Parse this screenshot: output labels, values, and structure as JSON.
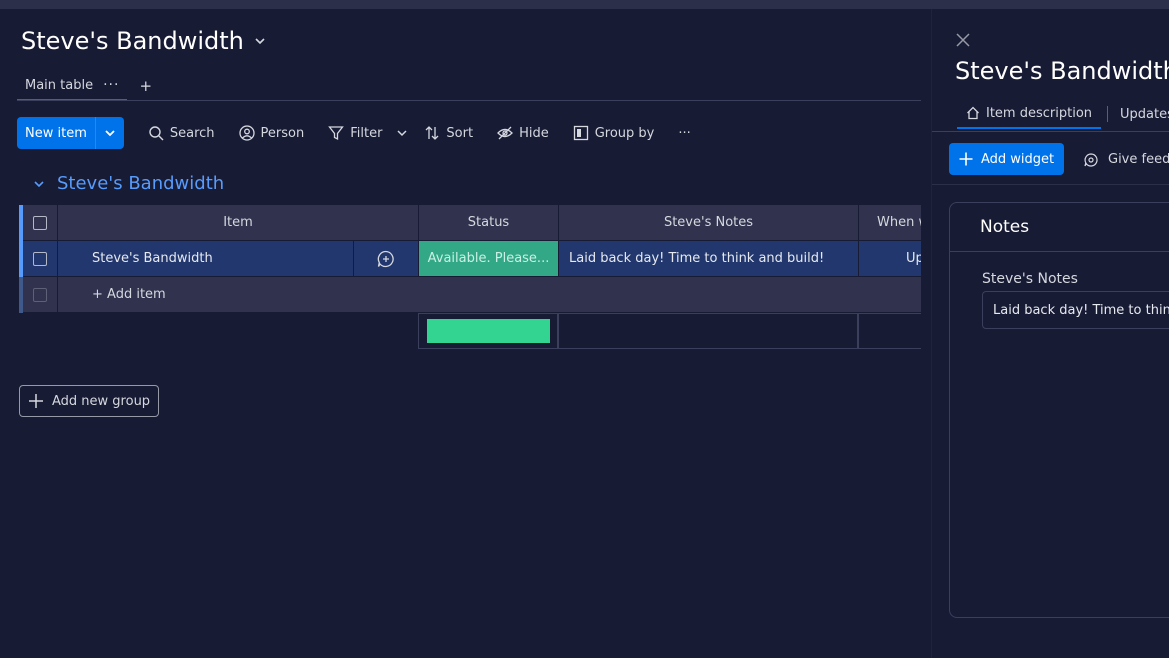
{
  "board": {
    "title": "Steve's Bandwidth",
    "tab_main": "Main table",
    "tab_dots": "···",
    "tab_add": "+"
  },
  "toolbar": {
    "new_item": "New item",
    "search": "Search",
    "person": "Person",
    "filter": "Filter",
    "sort": "Sort",
    "hide": "Hide",
    "group_by": "Group by",
    "more": "···"
  },
  "group": {
    "name": "Steve's Bandwidth",
    "color": "#579bfc",
    "columns": [
      "Item",
      "Status",
      "Steve's Notes",
      "When w"
    ],
    "rows": [
      {
        "item": "Steve's Bandwidth",
        "status": "Available. Please...",
        "notes": "Laid back day! Time to think and build!",
        "when": "Up"
      }
    ],
    "add_item": "+ Add item",
    "status_summary_color": "#33d391"
  },
  "add_group": "Add new group",
  "panel": {
    "title": "Steve's Bandwidth",
    "tabs": [
      "Item description",
      "Updates"
    ],
    "add_widget": "Add widget",
    "feedback": "Give feed",
    "notes_title": "Notes",
    "notes_label": "Steve's Notes",
    "notes_value": "Laid back day! Time to think"
  },
  "colors": {
    "background": "#181b34",
    "primary": "#0073ea",
    "status_green": "#33a887"
  }
}
